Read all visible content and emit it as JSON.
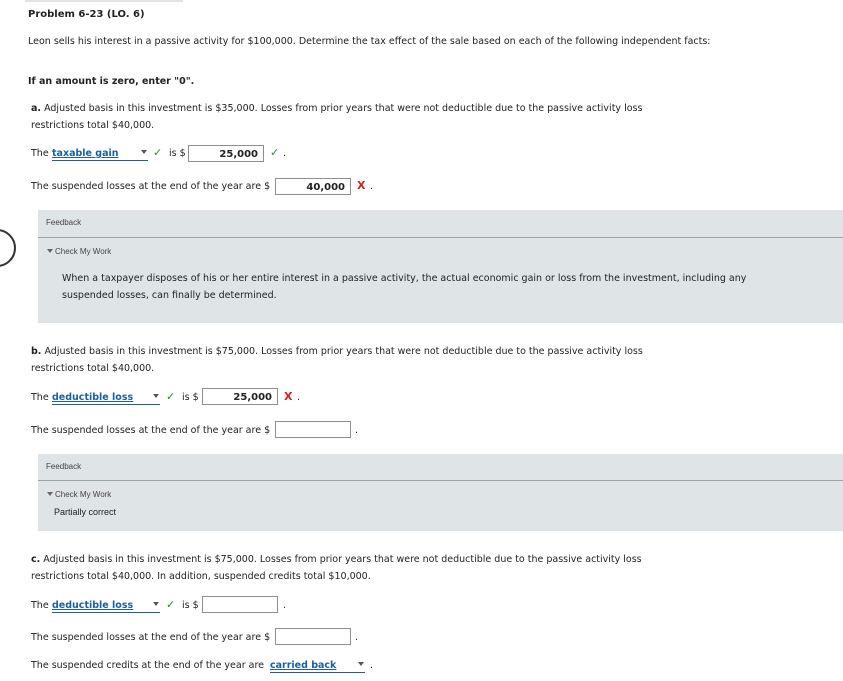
{
  "problem": {
    "title": "Problem 6-23 (LO. 6)",
    "intro": "Leon sells his interest in a passive activity for $100,000. Determine the tax effect of the sale based on each of the following independent facts:",
    "instruction": "If an amount is zero, enter \"0\"."
  },
  "part_a": {
    "label": "a.",
    "text": "Adjusted basis in this investment is $35,000. Losses from prior years that were not deductible due to the passive activity loss restrictions total $40,000.",
    "row1": {
      "prefix": "The",
      "select_value": "taxable gain",
      "is": "is $",
      "input_value": "25,000",
      "mark": "✓"
    },
    "row2": {
      "prefix": "The suspended losses at the end of the year are $",
      "input_value": "40,000",
      "mark": "X"
    },
    "feedback": {
      "header": "Feedback",
      "toggle": "Check My Work",
      "text": "When a taxpayer disposes of his or her entire interest in a passive activity, the actual economic gain or loss from the investment, including any suspended losses, can finally be determined."
    }
  },
  "part_b": {
    "label": "b.",
    "text": "Adjusted basis in this investment is $75,000. Losses from prior years that were not deductible due to the passive activity loss restrictions total $40,000.",
    "row1": {
      "prefix": "The",
      "select_value": "deductible loss",
      "is": "is $",
      "input_value": "25,000",
      "mark": "X"
    },
    "row2": {
      "prefix": "The suspended losses at the end of the year are $",
      "input_value": ""
    },
    "feedback": {
      "header": "Feedback",
      "toggle": "Check My Work",
      "text": "Partially correct"
    }
  },
  "part_c": {
    "label": "c.",
    "text": "Adjusted basis in this investment is $75,000. Losses from prior years that were not deductible due to the passive activity loss restrictions total $40,000. In addition, suspended credits total $10,000.",
    "row1": {
      "prefix": "The",
      "select_value": "deductible loss",
      "is": "is $",
      "input_value": ""
    },
    "row2": {
      "prefix": "The suspended losses at the end of the year are $",
      "input_value": ""
    },
    "row3": {
      "prefix": "The suspended credits at the end of the year are",
      "select_value": "carried back"
    }
  },
  "colors": {
    "link": "#1d5e9c",
    "correct": "#2f8f2f",
    "incorrect": "#d42020",
    "feedback_bg": "#dfe4e7"
  }
}
